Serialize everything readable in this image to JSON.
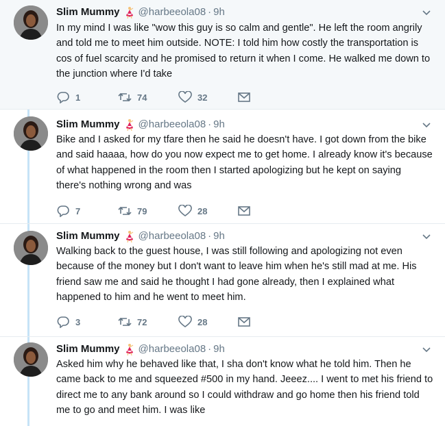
{
  "tweets": [
    {
      "name": "Slim Mummy",
      "handle": "@harbeeola08",
      "time": "9h",
      "text": "In my mind I was like \"wow this guy is so calm and gentle\". He left the room angrily and told me to meet him outside. NOTE: I told him how costly the transportation is cos of fuel scarcity and he promised to return it when I come. He walked me down to the junction where I'd take",
      "replies": "1",
      "retweets": "74",
      "likes": "32"
    },
    {
      "name": "Slim Mummy",
      "handle": "@harbeeola08",
      "time": "9h",
      "text": "Bike and I asked for my tfare then he said he doesn't have. I got down from the bike and said haaaa, how do you now expect me to get home. I already know it's because of what happened in the room then I started apologizing but he kept on saying there's nothing wrong and was",
      "replies": "7",
      "retweets": "79",
      "likes": "28"
    },
    {
      "name": "Slim Mummy",
      "handle": "@harbeeola08",
      "time": "9h",
      "text": "Walking back to the guest house, I was still following and apologizing not even because of the money but I don't want to leave him when he's still mad at me. His friend saw me and said he thought I had gone already, then I explained what happened to him and he went to meet him.",
      "replies": "3",
      "retweets": "72",
      "likes": "28"
    },
    {
      "name": "Slim Mummy",
      "handle": "@harbeeola08",
      "time": "9h",
      "text": "Asked him why he behaved like that, I sha don't know what he told him. Then he came back to me and squeezed #500 in my hand. Jeeez.... I went to met his friend to direct me to any bank around so I could withdraw and go home then his friend told me to go and meet him. I was like",
      "replies": "",
      "retweets": "",
      "likes": ""
    }
  ],
  "icons": {
    "name_emoji": "dancer-emoji-icon",
    "reply": "reply-icon",
    "retweet": "retweet-icon",
    "like": "heart-icon",
    "message": "envelope-icon",
    "caret": "chevron-down-icon"
  },
  "colors": {
    "text": "#14171a",
    "muted": "#657786",
    "thread_line": "#c6e3f7",
    "first_bg": "#f5f8fa"
  }
}
